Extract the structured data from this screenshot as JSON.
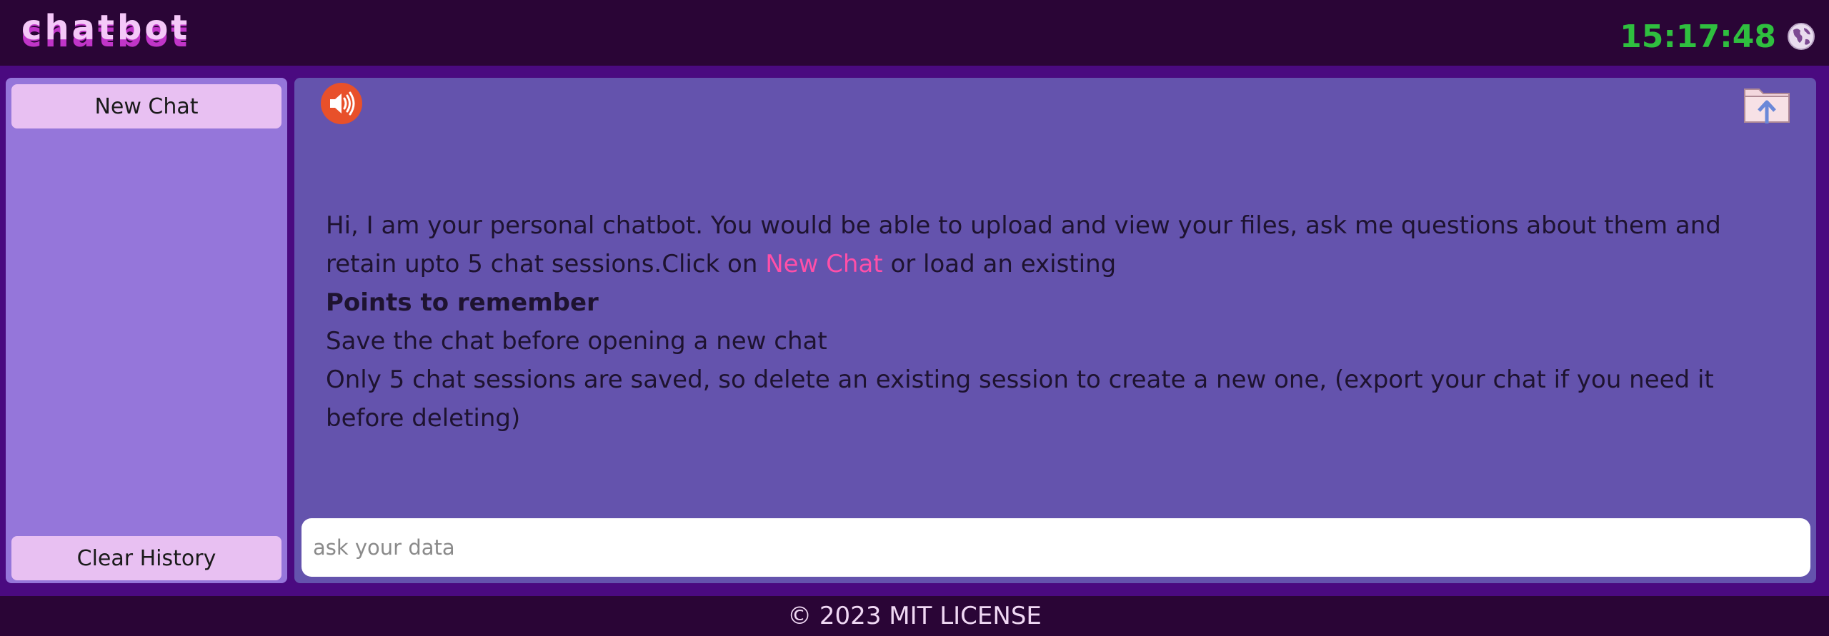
{
  "header": {
    "logo": "chatbot",
    "clock": "15:17:48",
    "globe_icon": "globe-icon"
  },
  "sidebar": {
    "new_chat_label": "New Chat",
    "clear_history_label": "Clear History"
  },
  "main": {
    "speaker_icon": "speaker-icon",
    "upload_icon": "upload-folder-icon",
    "message": {
      "line1": "Hi, I am your personal chatbot. You would be able to upload and view your files, ask me questions about them and retain upto 5 chat sessions.Click on",
      "link": "New Chat",
      "line1_tail": "or load an existing",
      "heading": "Points to remember",
      "point1": "Save the chat before opening a new chat",
      "point2": "Only 5 chat sessions are saved, so delete an existing session to create a new one, (export your chat if you need it before deleting)"
    },
    "input": {
      "placeholder": "ask your data",
      "value": ""
    }
  },
  "footer": {
    "text": "© 2023 MIT LICENSE"
  },
  "colors": {
    "header_bg": "#2a0536",
    "page_bg": "#4a0a80",
    "sidebar_bg": "#9576da",
    "main_bg": "#6453ad",
    "button_bg": "#e8c0f2",
    "clock": "#2fbf3f",
    "link": "#ff4fa8",
    "speaker": "#e8502a"
  }
}
